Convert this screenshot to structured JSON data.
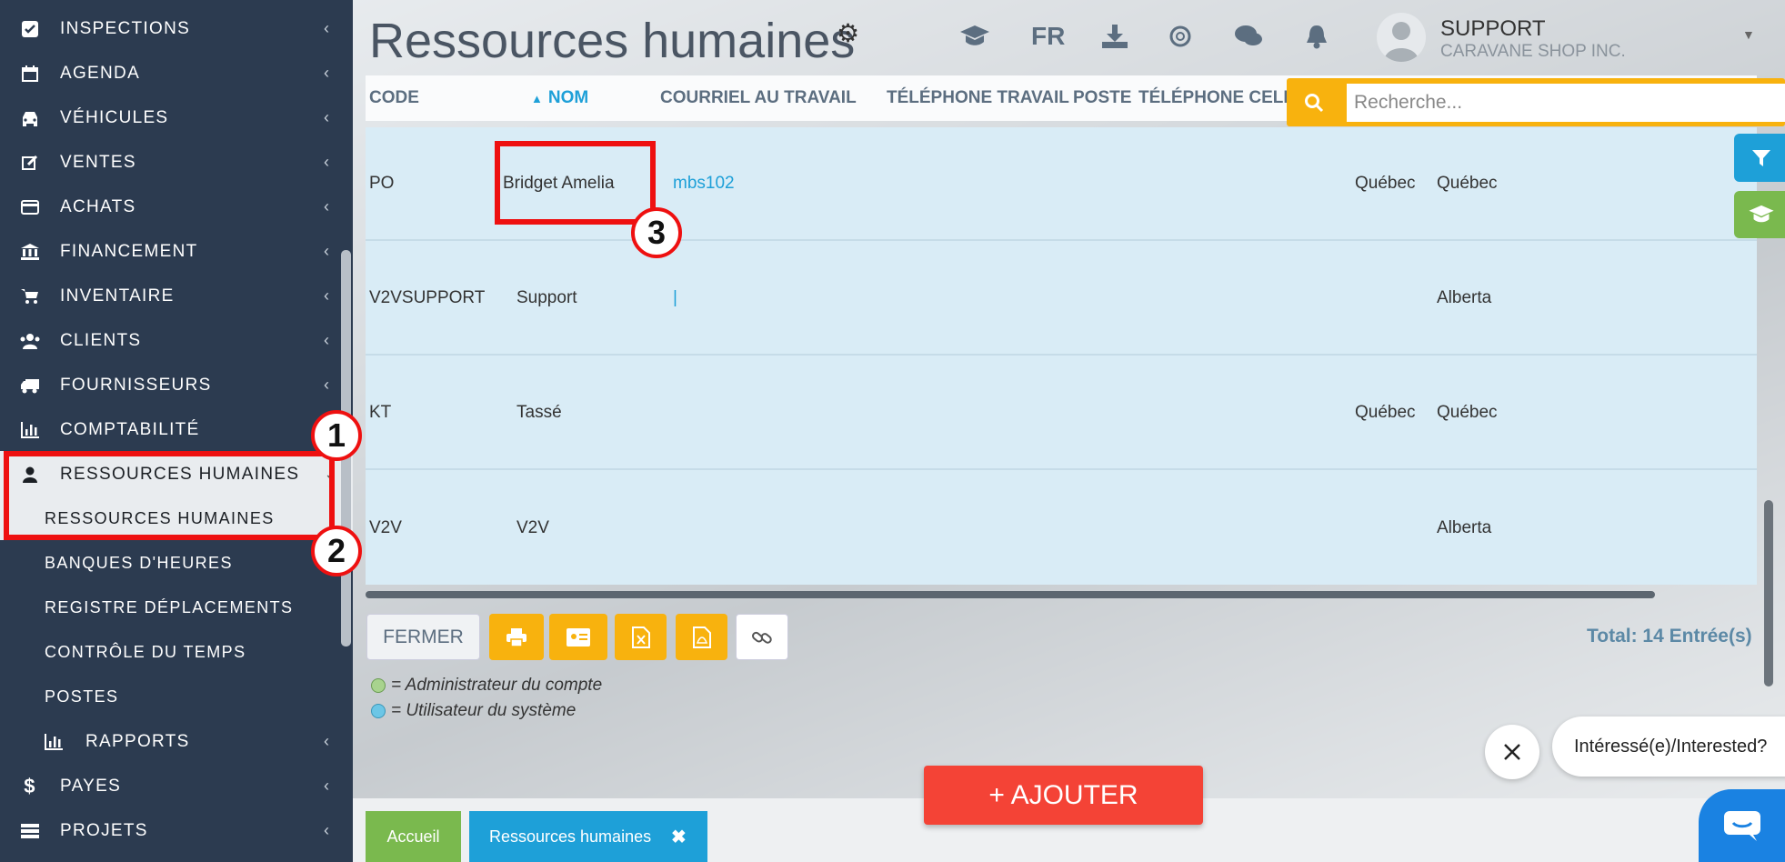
{
  "sidebar": {
    "items": [
      {
        "label": "INSPECTIONS",
        "icon": "check-square-icon"
      },
      {
        "label": "AGENDA",
        "icon": "calendar-icon"
      },
      {
        "label": "VÉHICULES",
        "icon": "car-icon"
      },
      {
        "label": "VENTES",
        "icon": "edit-icon"
      },
      {
        "label": "ACHATS",
        "icon": "credit-card-icon"
      },
      {
        "label": "FINANCEMENT",
        "icon": "bank-icon"
      },
      {
        "label": "INVENTAIRE",
        "icon": "cart-icon"
      },
      {
        "label": "CLIENTS",
        "icon": "users-icon"
      },
      {
        "label": "FOURNISSEURS",
        "icon": "truck-icon"
      },
      {
        "label": "COMPTABILITÉ",
        "icon": "bar-chart-icon"
      },
      {
        "label": "RESSOURCES HUMAINES",
        "icon": "user-icon"
      }
    ],
    "sub_items": [
      "RESSOURCES HUMAINES",
      "BANQUES D'HEURES",
      "REGISTRE DÉPLACEMENTS",
      "CONTRÔLE DU TEMPS",
      "POSTES"
    ],
    "rapports": {
      "label": "RAPPORTS",
      "icon": "bar-chart-icon"
    },
    "bottom_items": [
      {
        "label": "PAYES",
        "icon": "dollar-icon"
      },
      {
        "label": "PROJETS",
        "icon": "server-icon"
      }
    ]
  },
  "header": {
    "title": "Ressources humaines",
    "lang": "FR",
    "user_name": "SUPPORT",
    "company": "CARAVANE SHOP INC."
  },
  "table": {
    "columns": [
      "CODE",
      "NOM",
      "COURRIEL AU TRAVAIL",
      "TÉLÉPHONE TRAVAIL",
      "POSTE",
      "TÉLÉPHONE CELL"
    ],
    "sort_indicator": "▲",
    "rows": [
      {
        "code": "PO",
        "nom": "Bridget Amelia",
        "email": "mbs102",
        "city": "Québec",
        "province": "Québec"
      },
      {
        "code": "V2VSUPPORT",
        "nom": "Support",
        "email": "|",
        "city": "",
        "province": "Alberta"
      },
      {
        "code": "KT",
        "nom": "Tassé",
        "email": "",
        "city": "Québec",
        "province": "Québec"
      },
      {
        "code": "V2V",
        "nom": "V2V",
        "email": "",
        "city": "",
        "province": "Alberta"
      }
    ]
  },
  "search": {
    "placeholder": "Recherche..."
  },
  "actions": {
    "fermer": "FERMER",
    "total": "Total: 14 Entrée(s)"
  },
  "legend": {
    "admin": "= Administrateur du compte",
    "user": "= Utilisateur du système",
    "admin_color": "#a8d38e",
    "user_color": "#6cc6e6"
  },
  "chat": {
    "prompt": "Intéressé(e)/Interested?"
  },
  "ajouter": "+ AJOUTER",
  "tabs": {
    "accueil": "Accueil",
    "rh": "Ressources humaines"
  },
  "annotations": [
    "1",
    "2",
    "3"
  ],
  "colors": {
    "sidebar": "#2c3b50",
    "accent_yellow": "#f8b20e",
    "accent_blue": "#1ea0d8",
    "accent_green": "#7ab94e",
    "danger": "#f44336"
  }
}
